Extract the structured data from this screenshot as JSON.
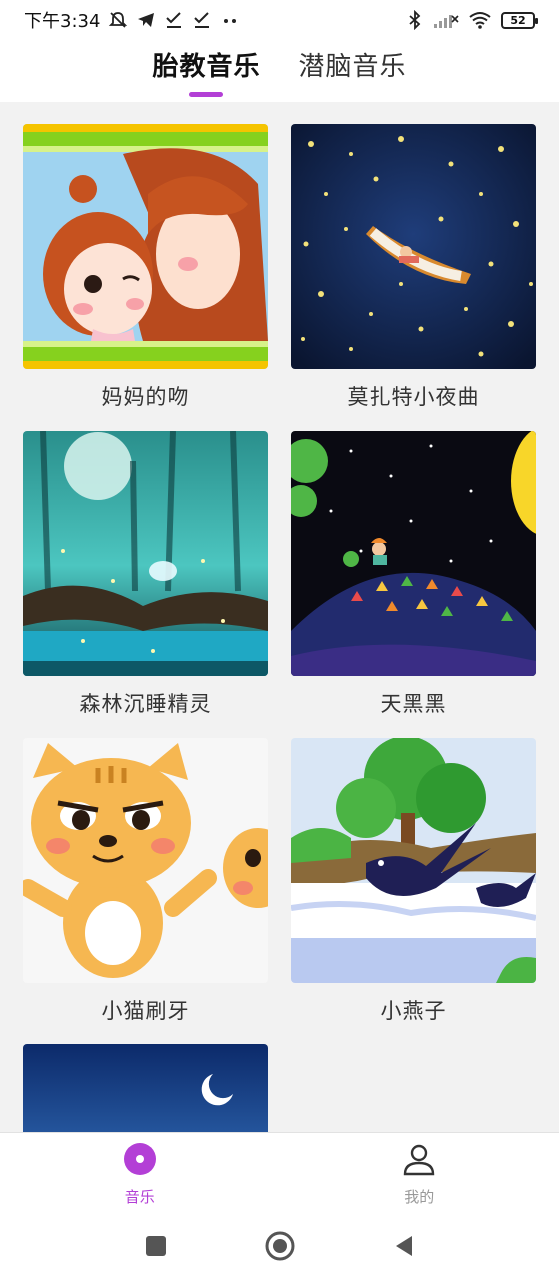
{
  "status_bar": {
    "time": "下午3:34",
    "icons_left": [
      "mute-icon",
      "telegram-icon",
      "check-icon",
      "check-icon",
      "more-dots-icon"
    ],
    "icons_right": [
      "bluetooth-icon",
      "cellular-signal-icon",
      "wifi-icon"
    ],
    "battery": "52"
  },
  "header": {
    "tabs": [
      {
        "label": "胎教音乐",
        "active": true
      },
      {
        "label": "潜脑音乐",
        "active": false
      }
    ],
    "accent": "#b33fd6"
  },
  "songs": [
    {
      "title": "妈妈的吻",
      "art": "mother-kiss-art"
    },
    {
      "title": "莫扎特小夜曲",
      "art": "night-boat-art"
    },
    {
      "title": "森林沉睡精灵",
      "art": "forest-spirit-art"
    },
    {
      "title": "天黑黑",
      "art": "night-sky-art"
    },
    {
      "title": "小猫刷牙",
      "art": "cat-art"
    },
    {
      "title": "小燕子",
      "art": "swallow-art"
    },
    {
      "title": "",
      "art": "dusk-moon-art"
    }
  ],
  "bottom_nav": {
    "items": [
      {
        "label": "音乐",
        "icon": "music-disc-icon",
        "active": true
      },
      {
        "label": "我的",
        "icon": "profile-icon",
        "active": false
      }
    ]
  },
  "system_nav": [
    "recent-apps-icon",
    "home-icon",
    "back-icon"
  ]
}
